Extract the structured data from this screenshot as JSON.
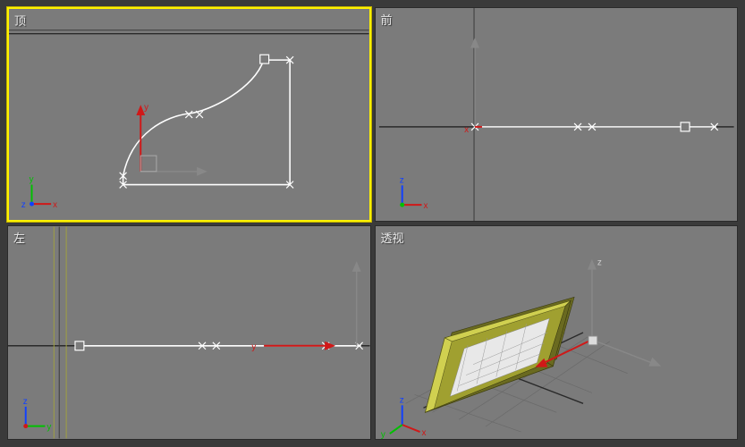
{
  "viewports": {
    "top": {
      "label": "顶",
      "active": true,
      "axes": [
        "x",
        "y"
      ]
    },
    "front": {
      "label": "前",
      "active": false,
      "axes": [
        "x",
        "z"
      ]
    },
    "left": {
      "label": "左",
      "active": false,
      "axes": [
        "y",
        "z"
      ]
    },
    "persp": {
      "label": "透视",
      "active": false,
      "axes": [
        "x",
        "y",
        "z"
      ]
    }
  },
  "axis_labels": {
    "x": "x",
    "y": "y",
    "z": "z"
  },
  "colors": {
    "viewport_bg": "#7b7b7b",
    "active_border": "#fff200",
    "axis_x": "#d01818",
    "axis_y": "#00c000",
    "axis_z": "#1040ff",
    "spline": "#ffffff",
    "object": "#a0a030"
  }
}
